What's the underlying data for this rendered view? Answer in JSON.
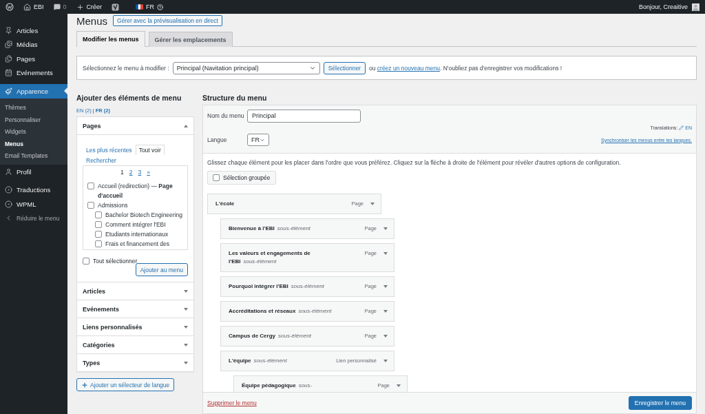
{
  "topbar": {
    "site": "EBI",
    "comments": "0",
    "create": "Créer",
    "language": "FR",
    "greeting": "Bonjour, Creaitive"
  },
  "sidebar": {
    "items": [
      {
        "label": "Articles",
        "selected": false
      },
      {
        "label": "Médias",
        "selected": false
      },
      {
        "label": "Pages",
        "selected": false
      },
      {
        "label": "Evénements",
        "selected": false
      },
      {
        "label": "Apparence",
        "selected": true,
        "children": [
          {
            "label": "Thèmes",
            "selected": false
          },
          {
            "label": "Personnaliser",
            "selected": false
          },
          {
            "label": "Widgets",
            "selected": false
          },
          {
            "label": "Menus",
            "selected": true
          },
          {
            "label": "Email Templates",
            "selected": false
          }
        ]
      },
      {
        "label": "Profil",
        "selected": false
      },
      {
        "label": "Traductions",
        "selected": false
      },
      {
        "label": "WPML",
        "selected": false
      },
      {
        "label": "Réduire le menu",
        "selected": false
      }
    ]
  },
  "header": {
    "title": "Menus",
    "button": "Gérer avec la prévisualisation en direct"
  },
  "tabs": [
    {
      "label": "Modifier les menus",
      "selected": true
    },
    {
      "label": "Gérer les emplacements",
      "selected": false
    }
  ],
  "menu_select": {
    "label": "Sélectionnez le menu à modifier :",
    "value": "Principal (Navitation principal)",
    "button": "Sélectionner",
    "hint_before": "ou",
    "hint_link": "créez un nouveau menu",
    "hint_after": ". N'oubliez pas d'enregistrer vos modifications !"
  },
  "add_items": {
    "title": "Ajouter des éléments de menu",
    "languages": [
      {
        "label": "EN (2)",
        "selected": false
      },
      {
        "label": "FR (2)",
        "selected": true
      }
    ],
    "language_separator": "|",
    "sections": [
      {
        "title": "Pages",
        "expanded": true,
        "tabs": [
          {
            "label": "Les plus récentes",
            "selected": false
          },
          {
            "label": "Tout voir",
            "selected": true
          },
          {
            "label": "Rechercher",
            "selected": false
          }
        ],
        "pagination": [
          {
            "label": "1",
            "selected": true
          },
          {
            "label": "2",
            "selected": false
          },
          {
            "label": "3",
            "selected": false
          },
          {
            "label": "»",
            "selected": false
          }
        ],
        "pages": [
          {
            "label": "Accueil (redirection) — **Page d'accueil**",
            "checked": false
          },
          {
            "label": "Admissions",
            "checked": false,
            "children": [
              {
                "label": "Bachelor Biotech Engineering",
                "checked": false
              },
              {
                "label": "Comment intégrer l'EBI",
                "checked": false
              },
              {
                "label": "Etudiants internationaux",
                "checked": false
              },
              {
                "label": "Frais et financement des",
                "checked": false
              }
            ]
          }
        ],
        "select_all": {
          "label": "Tout sélectionner",
          "checked": false
        },
        "button": "Ajouter au menu"
      },
      {
        "title": "Articles",
        "expanded": false
      },
      {
        "title": "Evénements",
        "expanded": false
      },
      {
        "title": "Liens personnalisés",
        "expanded": false
      },
      {
        "title": "Catégories",
        "expanded": false
      },
      {
        "title": "Types",
        "expanded": false
      }
    ],
    "language_button": "Ajouter un sélecteur de langue"
  },
  "structure": {
    "title": "Structure du menu",
    "name_label": "Nom du menu",
    "name_value": "Principal",
    "translations_label": "Translations:",
    "translations_link": "EN",
    "language_label": "Langue",
    "language_value": "FR",
    "sync_link": "Synchroniser les menus entre les langues.",
    "instructions": "Glissez chaque élément pour les placer dans l'ordre que vous préférez. Cliquez sur la flèche à droite de l'élément pour révéler d'autres options de configuration.",
    "bulk_select": {
      "label": "Sélection groupée",
      "checked": false
    },
    "items": [
      {
        "title": "L'école",
        "type": "Page",
        "children": [
          {
            "title": "Bienvenue à l'EBI",
            "note": "sous-élément",
            "type": "Page"
          },
          {
            "title": "Les valeurs et engagements de l'EBI",
            "note": "sous-élément",
            "type": "Page"
          },
          {
            "title": "Pourquoi intégrer l'EBI",
            "note": "sous-élément",
            "type": "Page"
          },
          {
            "title": "Accréditations et réseaux",
            "note": "sous-élément",
            "type": "Page"
          },
          {
            "title": "Campus de Cergy",
            "note": "sous-élément",
            "type": "Page"
          },
          {
            "title": "L'équipe",
            "note": "sous-élément",
            "type": "Lien personnalisé",
            "children": [
              {
                "title": "Équipe pédagogique",
                "note": "sous-",
                "type": "Page"
              }
            ]
          }
        ]
      }
    ],
    "delete_link": "Supprimer le menu",
    "save_button": "Enregistrer le menu"
  }
}
